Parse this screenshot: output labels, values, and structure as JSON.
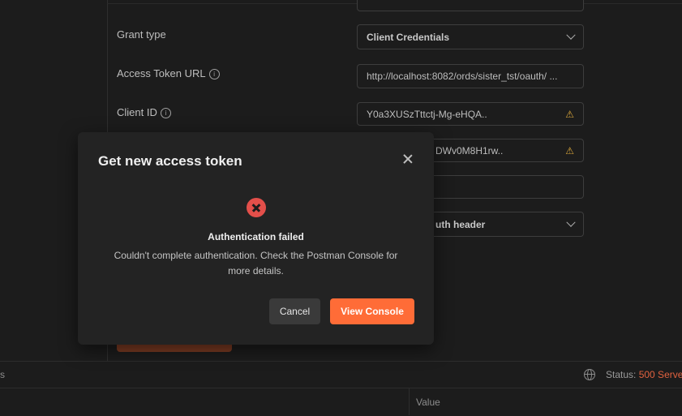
{
  "form": {
    "grant_type_label": "Grant type",
    "grant_type_value": "Client Credentials",
    "access_token_url_label": "Access Token URL",
    "access_token_url_value": "http://localhost:8082/ords/sister_tst/oauth/ ...",
    "client_id_label": "Client ID",
    "client_id_value": "Y0a3XUSzTttctj-Mg-eHQA..",
    "client_secret_value": "DWv0M8H1rw..",
    "client_auth_value": "uth header",
    "info_glyph": "i",
    "warning_glyph": "⚠"
  },
  "modal": {
    "title": "Get new access token",
    "error_title": "Authentication failed",
    "error_message": "Couldn't complete authentication. Check the Postman Console for more details.",
    "cancel_label": "Cancel",
    "view_console_label": "View Console"
  },
  "statusbar": {
    "cut_text": "s",
    "status_label": "Status:",
    "status_value": "500 Serve"
  },
  "table": {
    "value_header": "Value"
  },
  "colors": {
    "accent": "#ff6c37",
    "error": "#e34f4a",
    "warning": "#d8a53a",
    "status_error": "#e0613f"
  }
}
